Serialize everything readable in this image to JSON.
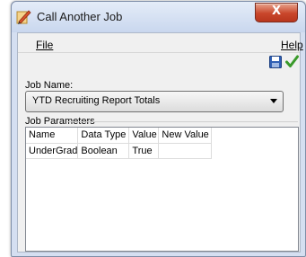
{
  "window": {
    "title": "Call Another Job",
    "close_label": "X"
  },
  "menu": {
    "file": "File",
    "help": "Help"
  },
  "toolbar": {
    "save_icon": "save-icon",
    "ok_icon": "checkmark-icon"
  },
  "job_name": {
    "label": "Job Name:",
    "selected": "YTD Recruiting Report Totals"
  },
  "job_parameters": {
    "label": "Job Parameters",
    "columns": [
      "Name",
      "Data Type",
      "Value",
      "New Value"
    ],
    "rows": [
      [
        "UnderGrad",
        "Boolean",
        "True",
        ""
      ]
    ]
  },
  "colors": {
    "check_green": "#3a9a2a",
    "save_blue": "#2f5fb4",
    "close_red": "#c9462b"
  }
}
